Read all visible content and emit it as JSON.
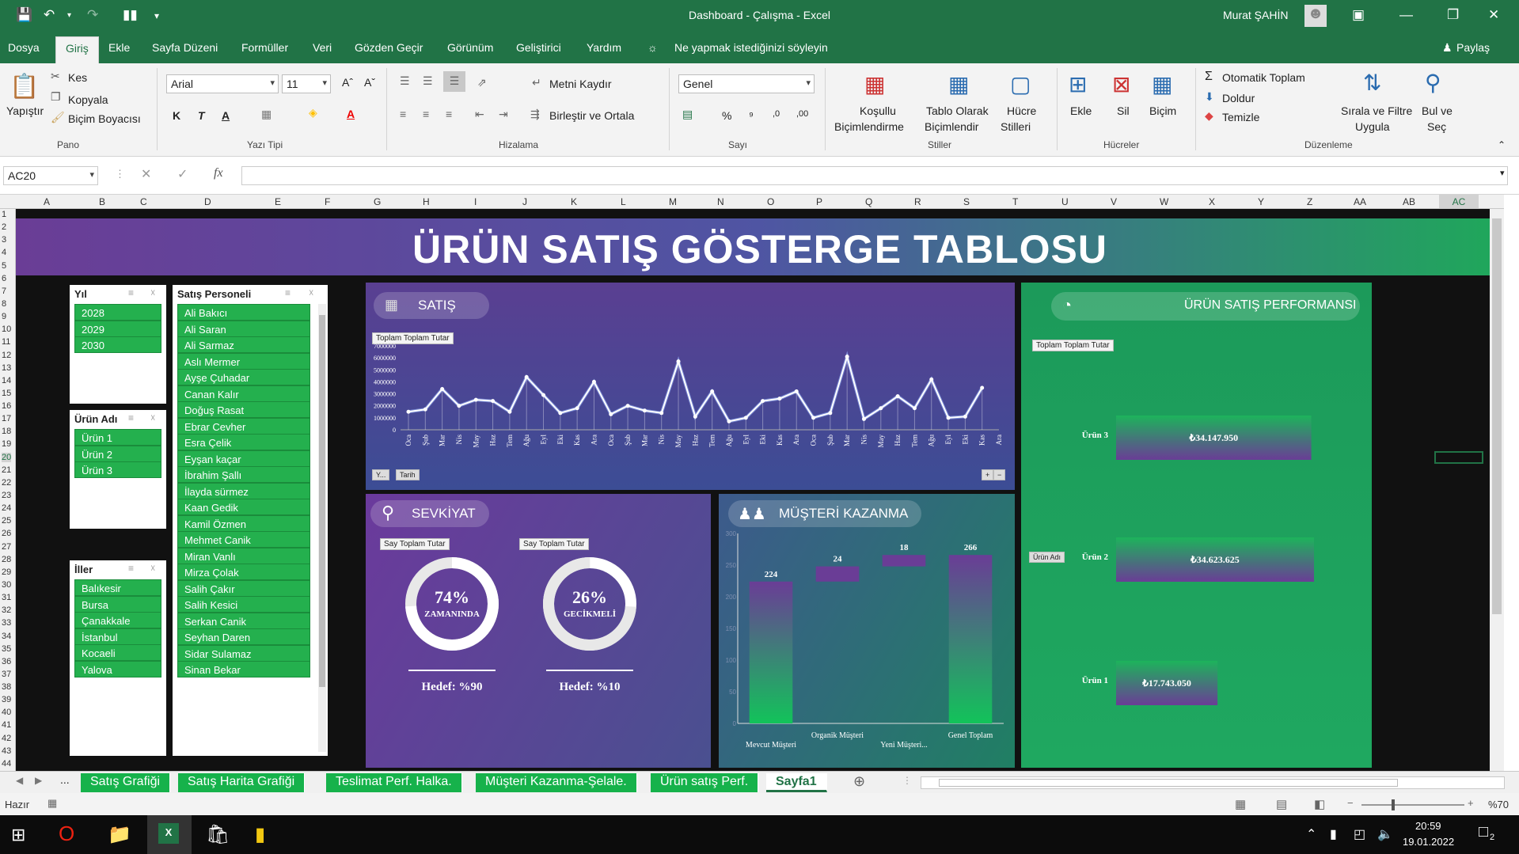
{
  "window": {
    "title": "Dashboard - Çalışma  -  Excel",
    "user": "Murat ŞAHİN"
  },
  "menu": {
    "tabs": [
      "Dosya",
      "Giriş",
      "Ekle",
      "Sayfa Düzeni",
      "Formüller",
      "Veri",
      "Gözden Geçir",
      "Görünüm",
      "Geliştirici",
      "Yardım"
    ],
    "tell_me": "Ne yapmak istediğinizi söyleyin",
    "share": "Paylaş"
  },
  "ribbon": {
    "clipboard": {
      "paste": "Yapıştır",
      "cut": "Kes",
      "copy": "Kopyala",
      "format_painter": "Biçim Boyacısı",
      "group": "Pano"
    },
    "font": {
      "name": "Arial",
      "size": "11",
      "bold": "K",
      "italic": "T",
      "underline": "A",
      "group": "Yazı Tipi"
    },
    "alignment": {
      "wrap": "Metni Kaydır",
      "merge": "Birleştir ve Ortala",
      "group": "Hizalama"
    },
    "number": {
      "format": "Genel",
      "percent": "%",
      "comma": "⁹",
      "group": "Sayı"
    },
    "styles": {
      "conditional_1": "Koşullu",
      "conditional_2": "Biçimlendirme",
      "table_1": "Tablo Olarak",
      "table_2": "Biçimlendir",
      "cell_1": "Hücre",
      "cell_2": "Stilleri",
      "group": "Stiller"
    },
    "cells": {
      "insert": "Ekle",
      "delete": "Sil",
      "format": "Biçim",
      "group": "Hücreler"
    },
    "editing": {
      "autosum": "Otomatik Toplam",
      "fill": "Doldur",
      "clear": "Temizle",
      "sort_1": "Sırala ve Filtre",
      "sort_2": "Uygula",
      "find_1": "Bul ve",
      "find_2": "Seç",
      "group": "Düzenleme"
    }
  },
  "formula_bar": {
    "name_box": "AC20",
    "fx": "fx",
    "value": ""
  },
  "columns": [
    "A",
    "B",
    "C",
    "D",
    "E",
    "F",
    "G",
    "H",
    "I",
    "J",
    "K",
    "L",
    "M",
    "N",
    "O",
    "P",
    "Q",
    "R",
    "S",
    "T",
    "U",
    "V",
    "W",
    "X",
    "Y",
    "Z",
    "AA",
    "AB",
    "AC"
  ],
  "rows": [
    "1",
    "2",
    "3",
    "4",
    "5",
    "6",
    "7",
    "8",
    "9",
    "10",
    "11",
    "12",
    "13",
    "14",
    "15",
    "16",
    "17",
    "18",
    "19",
    "20",
    "21",
    "22",
    "23",
    "24",
    "25",
    "26",
    "27",
    "28",
    "29",
    "30",
    "31",
    "32",
    "33",
    "34",
    "35",
    "36",
    "37",
    "38",
    "39",
    "40",
    "41",
    "42",
    "43",
    "44"
  ],
  "dashboard": {
    "title": "ÜRÜN SATIŞ GÖSTERGE TABLOSU",
    "slicer_year": {
      "header": "Yıl",
      "items": [
        "2028",
        "2029",
        "2030"
      ]
    },
    "slicer_product": {
      "header": "Ürün Adı",
      "items": [
        "Ürün 1",
        "Ürün 2",
        "Ürün 3"
      ]
    },
    "slicer_city": {
      "header": "İller",
      "items": [
        "Balıkesir",
        "Bursa",
        "Çanakkale",
        "İstanbul",
        "Kocaeli",
        "Yalova"
      ]
    },
    "slicer_staff": {
      "header": "Satış Personeli",
      "items": [
        "Ali Bakıcı",
        "Ali Saran",
        "Ali Sarmaz",
        "Aslı Mermer",
        "Ayşe Çuhadar",
        "Canan Kalır",
        "Doğuş Rasat",
        "Ebrar Cevher",
        "Esra Çelik",
        "Eyşan kaçar",
        "İbrahim Şallı",
        "İlayda sürmez",
        "Kaan Gedik",
        "Kamil Özmen",
        "Mehmet Canik",
        "Miran Vanlı",
        "Mirza Çolak",
        "Salih Çakır",
        "Salih Kesici",
        "Serkan Canik",
        "Seyhan Daren",
        "Sidar Sulamaz",
        "Sinan Bekar"
      ]
    },
    "sales": {
      "title": "SATIŞ",
      "field_tag": "Toplam Toplam Tutar",
      "filter_1": "Y...",
      "filter_2": "Tarih",
      "yticks": [
        "7000000",
        "6000000",
        "5000000",
        "4000000",
        "3000000",
        "2000000",
        "1000000",
        "0"
      ]
    },
    "shipment": {
      "title": "SEVKİYAT",
      "tag": "Say Toplam Tutar",
      "on_time_pct": "74%",
      "on_time_label": "ZAMANINDA",
      "on_time_target": "Hedef: %90",
      "late_pct": "26%",
      "late_label": "GECİKMELİ",
      "late_target": "Hedef: %10"
    },
    "customer": {
      "title": "MÜŞTERİ KAZANMA",
      "yticks": [
        "300",
        "250",
        "200",
        "150",
        "100",
        "50",
        "0"
      ]
    },
    "performance": {
      "title": "ÜRÜN SATIŞ PERFORMANSI",
      "field_tag": "Toplam Toplam Tutar",
      "filter": "Ürün Adı"
    }
  },
  "chart_data": [
    {
      "type": "line",
      "title": "SATIŞ",
      "ylabel": "",
      "ylim": [
        0,
        7000000
      ],
      "categories": [
        "Oca",
        "Şub",
        "Mar",
        "Nis",
        "May",
        "Haz",
        "Tem",
        "Ağu",
        "Eyl",
        "Eki",
        "Kas",
        "Ara",
        "Oca",
        "Şub",
        "Mar",
        "Nis",
        "May",
        "Haz",
        "Tem",
        "Ağu",
        "Eyl",
        "Eki",
        "Kas",
        "Ara",
        "Oca",
        "Şub",
        "Mar",
        "Nis",
        "May",
        "Haz",
        "Tem",
        "Ağu",
        "Eyl",
        "Eki",
        "Kas",
        "Ara"
      ],
      "series": [
        {
          "values": [
            1500000,
            1700000,
            3400000,
            2000000,
            2500000,
            2400000,
            1500000,
            4400000,
            2900000,
            1400000,
            1800000,
            4000000,
            1300000,
            2000000,
            1600000,
            1400000,
            5700000,
            1100000,
            3200000,
            700000,
            1000000,
            2400000,
            2600000,
            3200000,
            1000000,
            1400000,
            6100000,
            900000,
            1800000,
            2800000,
            1800000,
            4200000,
            1000000,
            1100000,
            3500000
          ]
        }
      ]
    },
    {
      "type": "pie",
      "title": "ZAMANINDA",
      "labels": [
        "ZAMANINDA",
        "GECİKMELİ"
      ],
      "values": [
        74,
        26
      ]
    },
    {
      "type": "pie",
      "title": "GECİKMELİ",
      "labels": [
        "GECİKMELİ",
        "ZAMANINDA"
      ],
      "values": [
        26,
        74
      ]
    },
    {
      "type": "bar",
      "title": "MÜŞTERİ KAZANMA",
      "categories": [
        "Mevcut Müşteri",
        "Organik Müşteri",
        "Yeni Müşteri...",
        "Genel Toplam"
      ],
      "values": [
        224,
        24,
        18,
        266
      ],
      "ylim": [
        0,
        300
      ]
    },
    {
      "type": "bar",
      "title": "ÜRÜN SATIŞ PERFORMANSI",
      "categories": [
        "Ürün 3",
        "Ürün 2",
        "Ürün 1"
      ],
      "values": [
        34147950,
        34623625,
        17743050
      ],
      "labels": [
        "₺34.147.950",
        "₺34.623.625",
        "₺17.743.050"
      ]
    }
  ],
  "sheet_tabs": [
    "Satış Grafiği",
    "Satış Harita Grafiği",
    "Teslimat Perf. Halka.",
    "Müşteri Kazanma-Şelale.",
    "Ürün satış Perf.",
    "Sayfa1"
  ],
  "status": {
    "ready": "Hazır",
    "zoom": "%70"
  },
  "taskbar": {
    "time": "20:59",
    "date": "19.01.2022",
    "notifications": "2"
  },
  "colors": {
    "excel_green": "#217346",
    "slicer_green": "#24b04e",
    "purple": "#6a3d96"
  }
}
